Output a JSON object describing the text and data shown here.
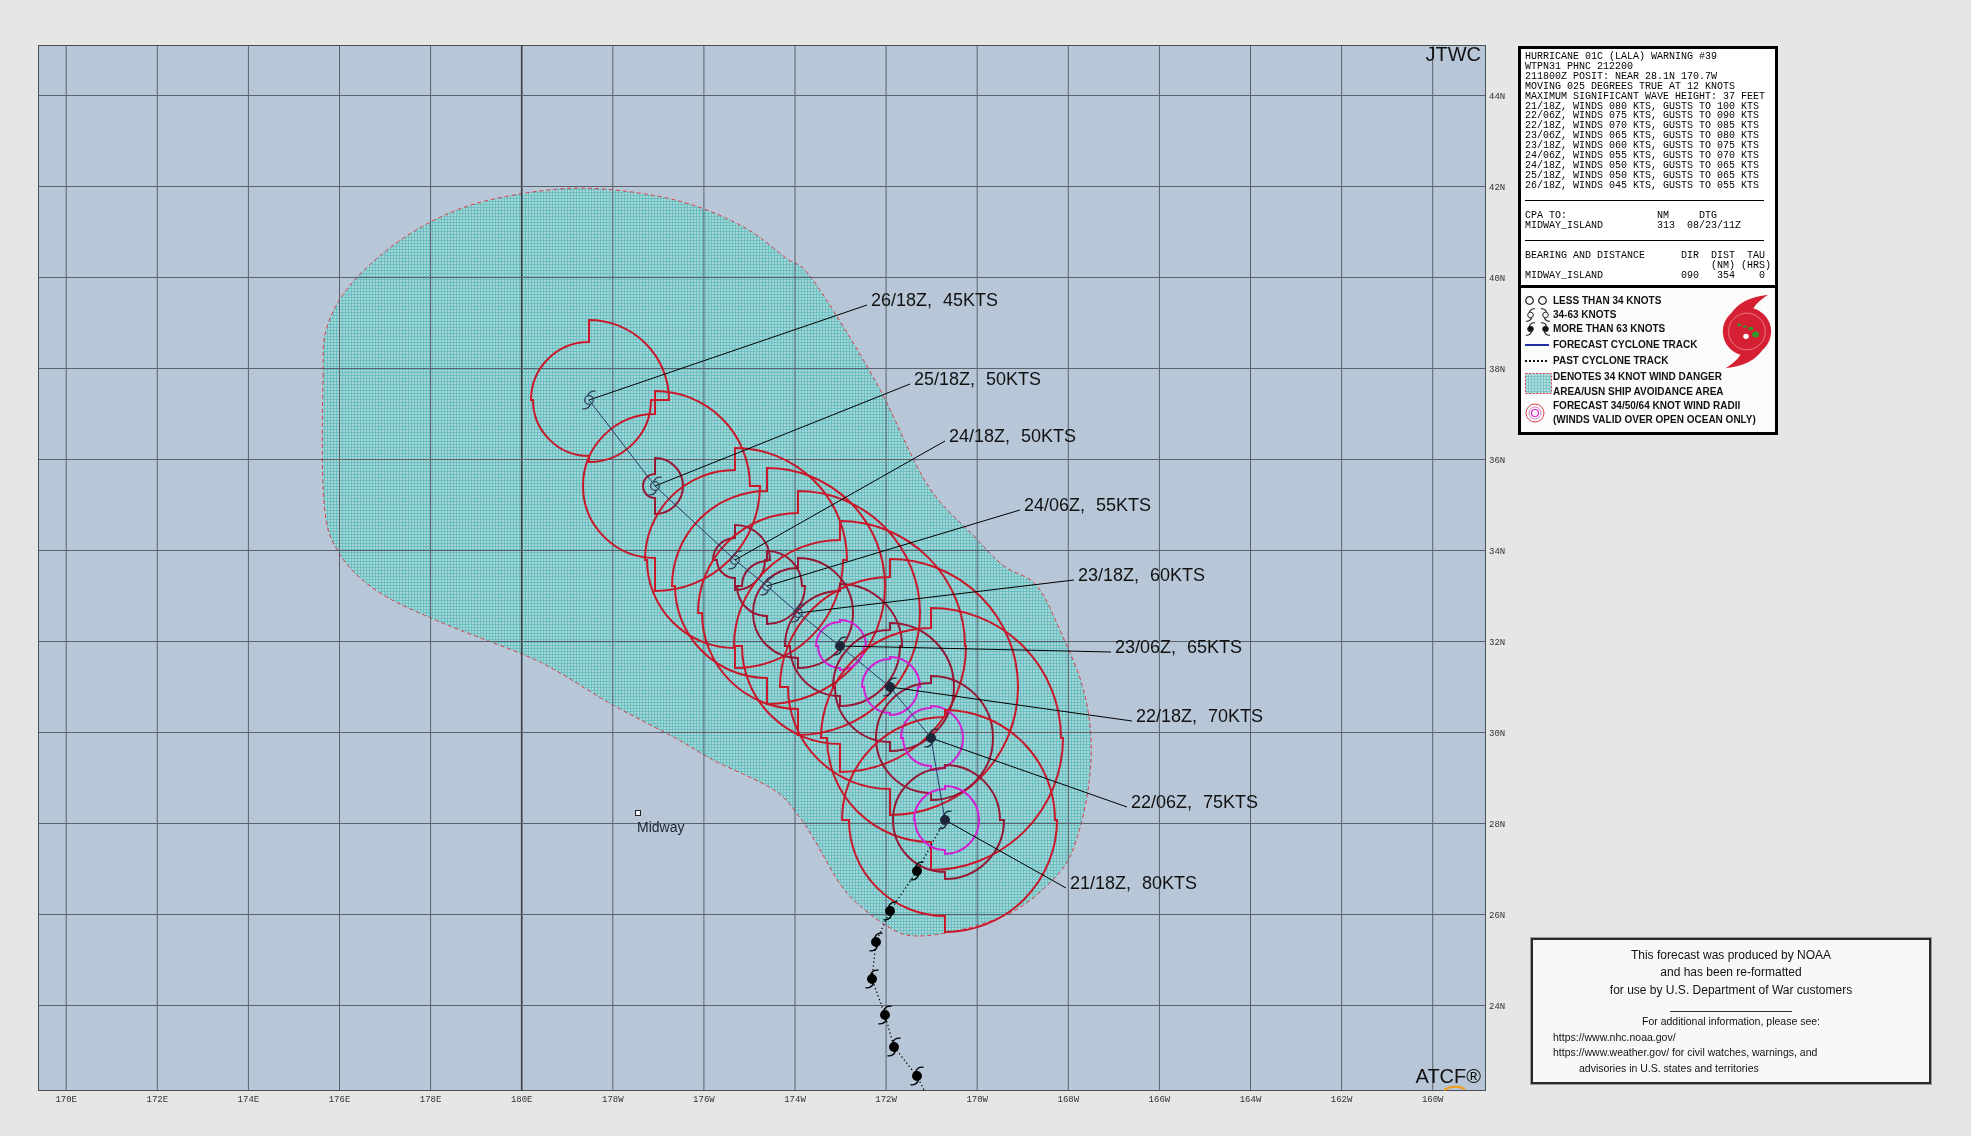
{
  "map": {
    "agency": "JTWC",
    "system_mark": "ATCF®",
    "longitude_labels": [
      "170E",
      "172E",
      "174E",
      "176E",
      "178E",
      "180E",
      "178W",
      "176W",
      "174W",
      "172W",
      "170W",
      "168W",
      "166W",
      "164W",
      "162W",
      "160W"
    ],
    "latitude_labels": [
      "44N",
      "42N",
      "40N",
      "38N",
      "36N",
      "34N",
      "32N",
      "30N",
      "28N",
      "26N",
      "24N"
    ],
    "place": {
      "name": "Midway"
    },
    "forecast_points": [
      {
        "label": "26/18Z, 45KTS",
        "kind": "storm"
      },
      {
        "label": "25/18Z, 50KTS",
        "kind": "storm"
      },
      {
        "label": "24/18Z, 50KTS",
        "kind": "storm"
      },
      {
        "label": "24/06Z, 55KTS",
        "kind": "storm"
      },
      {
        "label": "23/18Z, 60KTS",
        "kind": "storm"
      },
      {
        "label": "23/06Z, 65KTS",
        "kind": "hurricane"
      },
      {
        "label": "22/18Z, 70KTS",
        "kind": "hurricane"
      },
      {
        "label": "22/06Z, 75KTS",
        "kind": "hurricane"
      },
      {
        "label": "21/18Z, 80KTS",
        "kind": "hurricane"
      }
    ],
    "past_track": [
      {
        "kind": "hurricane"
      },
      {
        "kind": "hurricane"
      },
      {
        "kind": "hurricane"
      },
      {
        "kind": "hurricane"
      },
      {
        "kind": "hurricane"
      },
      {
        "kind": "hurricane"
      },
      {
        "kind": "hurricane"
      }
    ]
  },
  "warning": {
    "lines": [
      "HURRICANE 01C (LALA) WARNING #39",
      "WTPN31 PHNC 212200",
      "211800Z POSIT: NEAR 28.1N 170.7W",
      "MOVING 025 DEGREES TRUE AT 12 KNOTS",
      "MAXIMUM SIGNIFICANT WAVE HEIGHT: 37 FEET",
      "21/18Z, WINDS 080 KTS, GUSTS TO 100 KTS",
      "22/06Z, WINDS 075 KTS, GUSTS TO 090 KTS",
      "22/18Z, WINDS 070 KTS, GUSTS TO 085 KTS",
      "23/06Z, WINDS 065 KTS, GUSTS TO 080 KTS",
      "23/18Z, WINDS 060 KTS, GUSTS TO 075 KTS",
      "24/06Z, WINDS 055 KTS, GUSTS TO 070 KTS",
      "24/18Z, WINDS 050 KTS, GUSTS TO 065 KTS",
      "25/18Z, WINDS 050 KTS, GUSTS TO 065 KTS",
      "26/18Z, WINDS 045 KTS, GUSTS TO 055 KTS"
    ],
    "cpa": {
      "columns": [
        "CPA TO:",
        "NM",
        "DTG"
      ],
      "rows": [
        [
          "MIDWAY_ISLAND",
          "313",
          "08/23/11Z"
        ]
      ]
    },
    "bearing": {
      "columns": [
        "BEARING AND DISTANCE",
        "DIR",
        "DIST",
        "TAU"
      ],
      "units": [
        "(NM)",
        "(HRS)"
      ],
      "rows": [
        [
          "MIDWAY_ISLAND",
          "090",
          "354",
          "0"
        ]
      ]
    }
  },
  "legend": [
    {
      "kind": "open",
      "label": "LESS THAN 34 KNOTS"
    },
    {
      "kind": "storm",
      "label": "34-63 KNOTS"
    },
    {
      "kind": "hurricane",
      "label": "MORE THAN 63 KNOTS"
    },
    {
      "kind": "forecast",
      "label": "FORECAST CYCLONE TRACK"
    },
    {
      "kind": "past",
      "label": "PAST CYCLONE TRACK"
    },
    {
      "kind": "danger",
      "lines": [
        "DENOTES 34 KNOT WIND DANGER",
        "AREA/USN SHIP AVOIDANCE AREA"
      ]
    },
    {
      "kind": "radii",
      "lines": [
        "FORECAST 34/50/64 KNOT WIND RADII",
        "(WINDS VALID OVER OPEN OCEAN ONLY)"
      ]
    }
  ],
  "notice": {
    "lines": [
      "This forecast was produced by NOAA",
      "and has been re-formatted",
      "for use by U.S. Department of War customers"
    ],
    "see_also": "For additional information, please see:",
    "references": [
      {
        "lines": [
          "https://www.nhc.noaa.gov/"
        ]
      },
      {
        "lines": [
          "https://www.weather.gov/ for civil watches, warnings, and",
          "advisories in U.S. states and territories"
        ]
      }
    ]
  }
}
